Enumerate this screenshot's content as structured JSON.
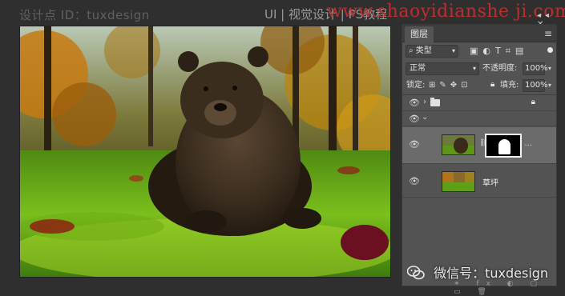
{
  "header": {
    "designer_id": "设计点 ID：tuxdesign",
    "title": "UI | 视觉设计 | PS教程",
    "watermark_url": "www.shaoyidianshe ji.com"
  },
  "layers_panel": {
    "tab_label": "图层",
    "menu_icon": "≡",
    "filter": {
      "kind_label": "类型",
      "search_icon": "⌕",
      "icons": "▣◐T⌗▤"
    },
    "blend_mode": "正常",
    "opacity_label": "不透明度:",
    "opacity_value": "100%",
    "lock_label": "锁定:",
    "lock_icons": "⊞✎✥⊡",
    "fill_label": "填充:",
    "fill_value": "100%",
    "layers": [
      {
        "type": "group",
        "expanded": false,
        "locked": true
      },
      {
        "type": "group",
        "expanded": true
      },
      {
        "type": "image-with-mask",
        "name": "",
        "selected": true,
        "more": "..."
      },
      {
        "type": "image",
        "name": "草坪"
      }
    ]
  },
  "wechat": {
    "text": "微信号：tuxdesign"
  },
  "colors": {
    "background": "#2f2f2f",
    "panel": "#535353",
    "selected_row": "#6b6b6b",
    "watermark_red": "#c62f2f"
  }
}
